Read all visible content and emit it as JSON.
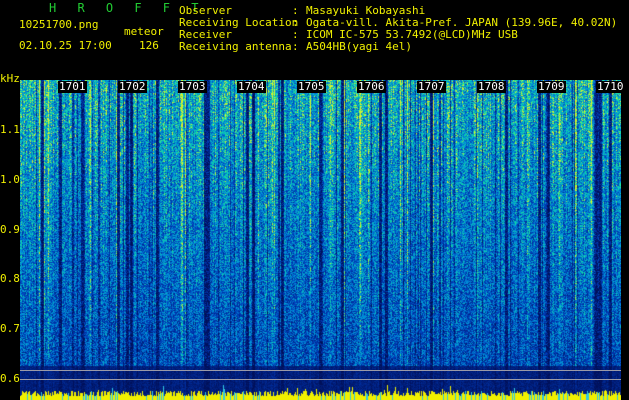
{
  "header": {
    "brand": "H R O F F T",
    "filename": "10251700.png",
    "meteor_label": "meteor",
    "datetime": "02.10.25 17:00",
    "meteor_count": "126",
    "info_labels": {
      "observer": "Observer",
      "location": "Receiving Location",
      "receiver": "Receiver",
      "antenna": "Receiving antenna"
    },
    "separator": ":",
    "info_values": {
      "observer": "Masayuki Kobayashi",
      "location": "Ogata-vill. Akita-Pref. JAPAN (139.96E, 40.02N)",
      "receiver": "ICOM IC-575 53.7492(@LCD)MHz USB",
      "antenna": "A504HB(yagi 4el)"
    }
  },
  "axis": {
    "unit": "kHz",
    "ticks": [
      "1.1",
      "1.0",
      "0.9",
      "0.8",
      "0.7",
      "0.6"
    ]
  },
  "time_labels": [
    "1701",
    "1702",
    "1703",
    "1704",
    "1705",
    "1706",
    "1707",
    "1708",
    "1709",
    "1710"
  ],
  "colors": {
    "background": "#000000",
    "text_primary": "#f0f000",
    "brand": "#22cc33",
    "spectrum_low": "#00106a",
    "spectrum_mid": "#0070c8",
    "spectrum_high": "#20d0a0",
    "signal_bar": "#f0f000"
  }
}
